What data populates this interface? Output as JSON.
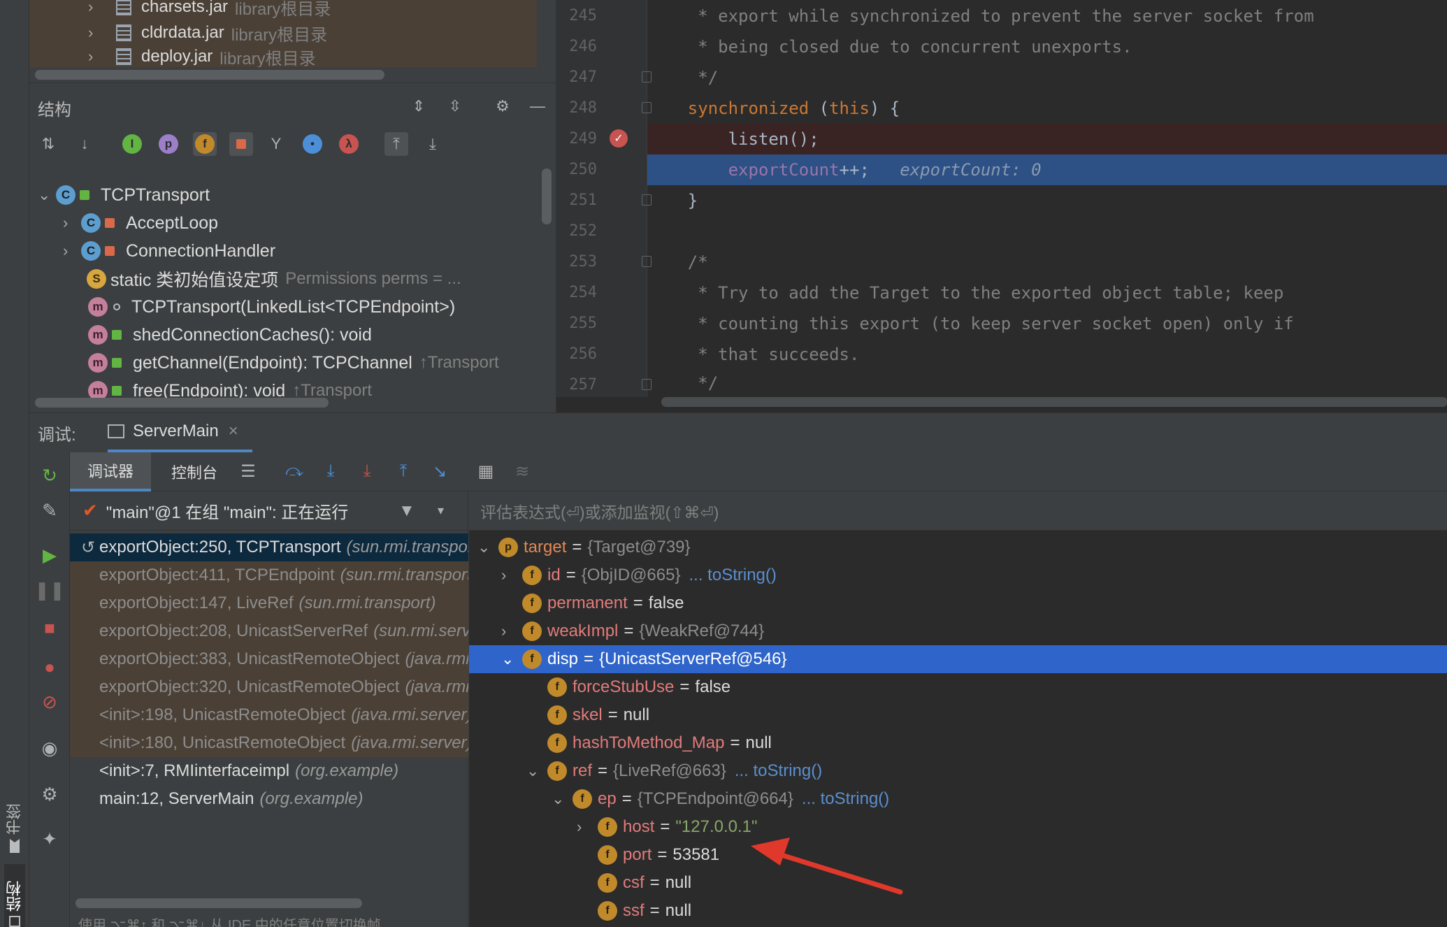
{
  "stripe": {
    "bookmarks_label": "书签",
    "structure_label": "结构"
  },
  "project": {
    "rows": [
      {
        "name": "charsets.jar",
        "note": "library根目录"
      },
      {
        "name": "cldrdata.jar",
        "note": "library根目录"
      },
      {
        "name": "deploy.jar",
        "note": "library根目录"
      }
    ]
  },
  "structure": {
    "title": "结构",
    "nodes": [
      {
        "label": "TCPTransport",
        "badge": "C",
        "note": ""
      },
      {
        "label": "AcceptLoop",
        "badge": "C",
        "note": ""
      },
      {
        "label": "ConnectionHandler",
        "badge": "C",
        "note": ""
      },
      {
        "label": "static 类初始值设定项",
        "badge": "S",
        "note": "Permissions perms = ..."
      },
      {
        "label": "TCPTransport(LinkedList<TCPEndpoint>)",
        "badge": "m",
        "note": ""
      },
      {
        "label": "shedConnectionCaches(): void",
        "badge": "m",
        "note": ""
      },
      {
        "label": "getChannel(Endpoint): TCPChannel",
        "badge": "m",
        "note": "↑Transport"
      },
      {
        "label": "free(Endpoint): void",
        "badge": "m",
        "note": "↑Transport"
      }
    ]
  },
  "editor": {
    "lines": [
      {
        "num": "245",
        "text": "     * export while synchronized to prevent the server socket from"
      },
      {
        "num": "246",
        "text": "     * being closed due to concurrent unexports."
      },
      {
        "num": "247",
        "text": "     */"
      },
      {
        "num": "248",
        "kw": "synchronized",
        "rest": " (",
        "kw2": "this",
        "rest2": ") {"
      },
      {
        "num": "249",
        "text": "        listen();"
      },
      {
        "num": "250",
        "field": "exportCount",
        "rest": "++;",
        "hint": "exportCount: 0"
      },
      {
        "num": "251",
        "text": "    }"
      },
      {
        "num": "252",
        "text": ""
      },
      {
        "num": "253",
        "text": "    /*"
      },
      {
        "num": "254",
        "text": "     * Try to add the Target to the exported object table; keep"
      },
      {
        "num": "255",
        "text": "     * counting this export (to keep server socket open) only if"
      },
      {
        "num": "256",
        "text": "     * that succeeds."
      },
      {
        "num": "257",
        "text": "     */"
      }
    ],
    "breakpoint_glyph": "✓"
  },
  "debug": {
    "label": "调试:",
    "session_tab": "ServerMain",
    "close_glyph": "×",
    "subtabs": {
      "debugger": "调试器",
      "console": "控制台"
    },
    "thread": "\"main\"@1 在组 \"main\": 正在运行",
    "eval_placeholder": "评估表达式(⏎)或添加监视(⇧⌘⏎)",
    "frames": [
      {
        "method": "exportObject:250, TCPTransport",
        "pkg": "(sun.rmi.transport.tcp)",
        "kind": "current"
      },
      {
        "method": "exportObject:411, TCPEndpoint",
        "pkg": "(sun.rmi.transport.tcp)",
        "kind": "lib"
      },
      {
        "method": "exportObject:147, LiveRef",
        "pkg": "(sun.rmi.transport)",
        "kind": "lib"
      },
      {
        "method": "exportObject:208, UnicastServerRef",
        "pkg": "(sun.rmi.server)",
        "kind": "lib"
      },
      {
        "method": "exportObject:383, UnicastRemoteObject",
        "pkg": "(java.rmi.server)",
        "kind": "lib"
      },
      {
        "method": "exportObject:320, UnicastRemoteObject",
        "pkg": "(java.rmi.server)",
        "kind": "lib"
      },
      {
        "method": "<init>:198, UnicastRemoteObject",
        "pkg": "(java.rmi.server)",
        "kind": "lib"
      },
      {
        "method": "<init>:180, UnicastRemoteObject",
        "pkg": "(java.rmi.server)",
        "kind": "lib"
      },
      {
        "method": "<init>:7, RMIinterfaceimpl",
        "pkg": "(org.example)",
        "kind": "user"
      },
      {
        "method": "main:12, ServerMain",
        "pkg": "(org.example)",
        "kind": "user"
      }
    ],
    "frames_footer": "使用 ⌥⌘↑ 和 ⌥⌘↓ 从 IDE 中的任意位置切换帧",
    "variables": [
      {
        "name": "target",
        "eq": "=",
        "value": "{Target@739}",
        "badge": "p",
        "link": ""
      },
      {
        "name": "id",
        "eq": "=",
        "value": "{ObjID@665}",
        "badge": "f",
        "link": "... toString()"
      },
      {
        "name": "permanent",
        "eq": "=",
        "value": "false",
        "badge": "f",
        "link": ""
      },
      {
        "name": "weakImpl",
        "eq": "=",
        "value": "{WeakRef@744}",
        "badge": "f",
        "link": ""
      },
      {
        "name": "disp",
        "eq": "=",
        "value": "{UnicastServerRef@546}",
        "badge": "f",
        "link": ""
      },
      {
        "name": "forceStubUse",
        "eq": "=",
        "value": "false",
        "badge": "f",
        "link": ""
      },
      {
        "name": "skel",
        "eq": "=",
        "value": "null",
        "badge": "f",
        "link": ""
      },
      {
        "name": "hashToMethod_Map",
        "eq": "=",
        "value": "null",
        "badge": "f",
        "link": ""
      },
      {
        "name": "ref",
        "eq": "=",
        "value": "{LiveRef@663}",
        "badge": "f",
        "link": "... toString()"
      },
      {
        "name": "ep",
        "eq": "=",
        "value": "{TCPEndpoint@664}",
        "badge": "f",
        "link": "... toString()"
      },
      {
        "name": "host",
        "eq": "=",
        "value": "\"127.0.0.1\"",
        "badge": "f",
        "link": ""
      },
      {
        "name": "port",
        "eq": "=",
        "value": "53581",
        "badge": "f",
        "link": ""
      },
      {
        "name": "csf",
        "eq": "=",
        "value": "null",
        "badge": "f",
        "link": ""
      },
      {
        "name": "ssf",
        "eq": "=",
        "value": "null",
        "badge": "f",
        "link": ""
      }
    ]
  },
  "colors": {
    "annotation_arrow": "#e0392b",
    "selection": "#2f65ca",
    "exec_line": "#2d5085"
  }
}
